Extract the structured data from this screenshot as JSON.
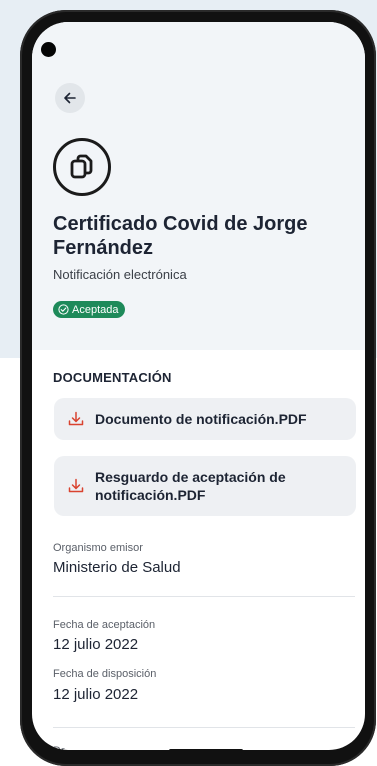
{
  "header": {
    "title": "Certificado Covid de Jorge Fernández",
    "subtitle": "Notificación electrónica",
    "status_badge": "Aceptada",
    "status_color": "#1e8a5a"
  },
  "documentation": {
    "section_title": "DOCUMENTACIÓN",
    "documents": [
      {
        "label": "Documento de notificación.PDF",
        "icon": "download-icon"
      },
      {
        "label": "Resguardo de aceptación de notificación.PDF",
        "icon": "download-icon"
      }
    ]
  },
  "details": {
    "issuer_label": "Organismo emisor",
    "issuer_value": "Ministerio de Salud",
    "accept_date_label": "Fecha de aceptación",
    "accept_date_value": "12 julio 2022",
    "disposal_date_label": "Fecha de disposición",
    "disposal_date_value": "12 julio 2022",
    "next_label_partial": "Dr"
  },
  "icons": {
    "back": "arrow-left-icon",
    "document": "copy-document-icon",
    "badge": "check-circle-icon"
  },
  "colors": {
    "accent_red": "#d9432f",
    "text_dark": "#1d2433"
  }
}
